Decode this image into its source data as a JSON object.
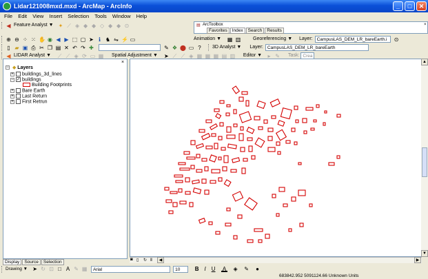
{
  "window": {
    "title": "Lidar121008mxd.mxd - ArcMap - ArcInfo"
  },
  "menu": [
    "File",
    "Edit",
    "View",
    "Insert",
    "Selection",
    "Tools",
    "Window",
    "Help"
  ],
  "toolbar1": {
    "feature_analyst": "Feature Analyst ▼",
    "arctoolbox": "ArcToolbox",
    "toolbox_tabs": [
      "Favorites",
      "Index",
      "Search",
      "Results"
    ]
  },
  "toolbar2": {
    "animation": "Animation ▼",
    "georeferencing": "Georeferencing ▼",
    "layer_label": "Layer:",
    "layer_value": "CampusLAS_DEM_LR_bareEarth.i"
  },
  "toolbar3": {
    "scale": "",
    "analyst_3d": "3D Analyst ▼",
    "layer_label": "Layer:",
    "layer_value": "CampusLAS_DEM_LR_bareEarth"
  },
  "toolbar4": {
    "lidar": "LIDAR Analyst ▼",
    "spatial_adjustment": "Spatial Adjustment ▼",
    "editor": "Editor ▼",
    "task_label": "Task:",
    "task_value": "Crea"
  },
  "toc": {
    "root": "Layers",
    "items": [
      {
        "label": "buildings_3d_lines",
        "checked": false,
        "indent": 1
      },
      {
        "label": "buildings",
        "checked": true,
        "indent": 1
      },
      {
        "label": "Building Footprints",
        "symbol": true,
        "indent": 2
      },
      {
        "label": "Bare Earth",
        "checked": false,
        "indent": 1
      },
      {
        "label": "Last Return",
        "checked": false,
        "indent": 1
      },
      {
        "label": "First Retrun",
        "checked": false,
        "indent": 1
      }
    ],
    "tabs": [
      "Display",
      "Source",
      "Selection"
    ]
  },
  "drawing": {
    "label": "Drawing ▼",
    "font": "Arial",
    "size": "10"
  },
  "status": {
    "coords": "683842.952  5091124.66 Unknown Units"
  },
  "colors": {
    "building_stroke": "#d40000"
  }
}
